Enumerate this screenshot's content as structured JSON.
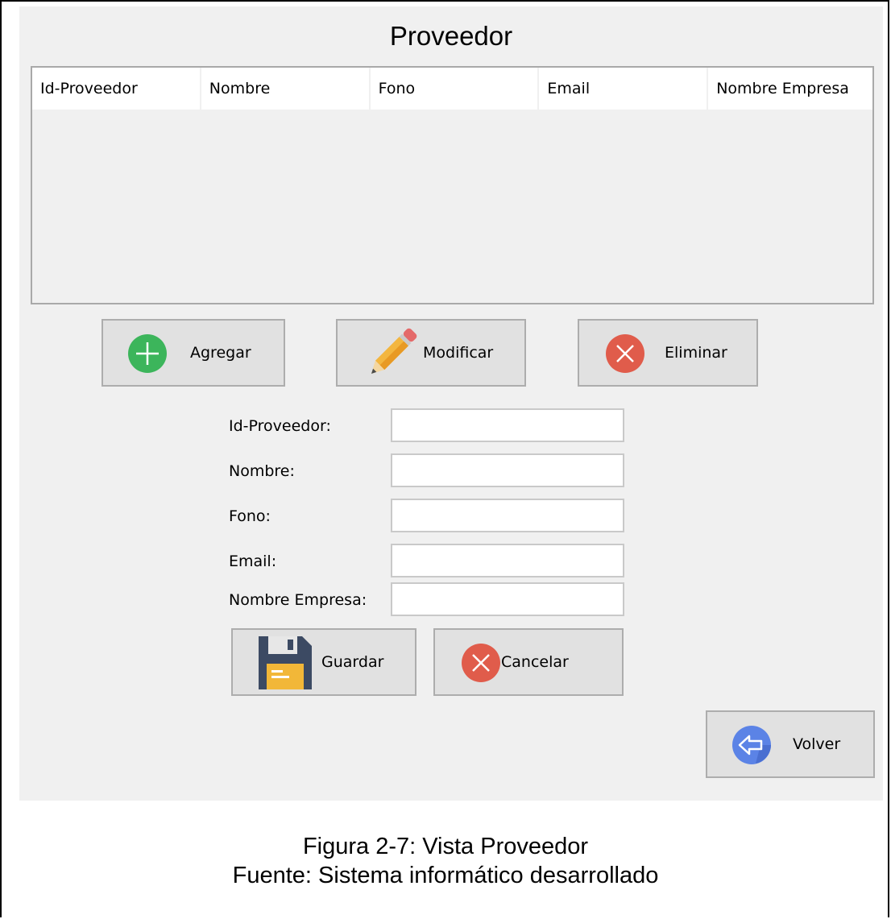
{
  "window": {
    "title": "Proveedor"
  },
  "table": {
    "columns": [
      "Id-Proveedor",
      "Nombre",
      "Fono",
      "Email",
      "Nombre Empresa"
    ],
    "rows": []
  },
  "actions": {
    "add_label": "Agregar",
    "edit_label": "Modificar",
    "delete_label": "Eliminar"
  },
  "form": {
    "fields": [
      {
        "label": "Id-Proveedor:",
        "value": ""
      },
      {
        "label": "Nombre:",
        "value": ""
      },
      {
        "label": "Fono:",
        "value": ""
      },
      {
        "label": "Email:",
        "value": ""
      },
      {
        "label": "Nombre Empresa:",
        "value": ""
      }
    ],
    "save_label": "Guardar",
    "cancel_label": "Cancelar"
  },
  "nav": {
    "back_label": "Volver"
  },
  "caption": {
    "line1": "Figura 2-7: Vista Proveedor",
    "line2": "Fuente: Sistema informático desarrollado"
  },
  "colors": {
    "add_green": "#3cb55b",
    "delete_red": "#e05c4b",
    "back_blue": "#5b83e6",
    "window_bg": "#f0f0f0"
  },
  "icons": {
    "add": "plus-circle-icon",
    "edit": "pencil-icon",
    "delete": "x-circle-icon",
    "save": "floppy-disk-icon",
    "cancel": "x-circle-icon",
    "back": "arrow-left-circle-icon"
  }
}
